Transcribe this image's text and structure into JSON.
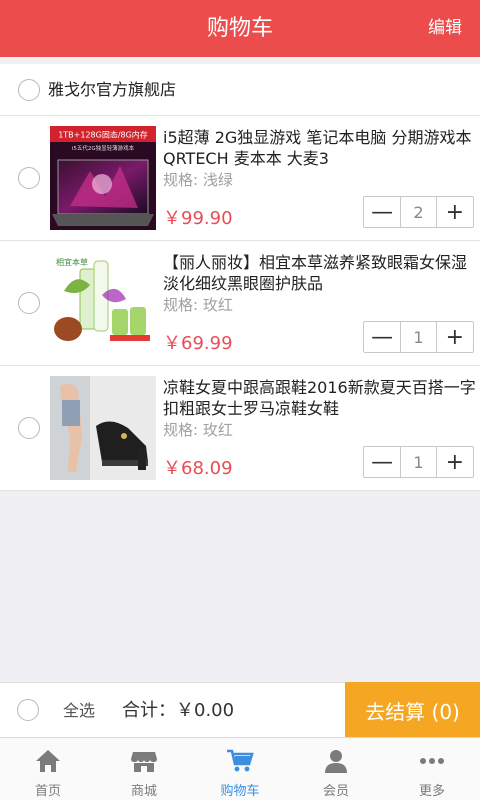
{
  "header": {
    "title": "购物车",
    "edit_label": "编辑"
  },
  "store": {
    "name": "雅戈尔官方旗舰店"
  },
  "items": [
    {
      "name": "i5超薄 2G独显游戏 笔记本电脑 分期游戏本 QRTECH 麦本本 大麦3",
      "spec": "规格: 浅绿",
      "price": "￥99.90",
      "qty": "2",
      "thumb_text_1": "1TB+128G固态/8G内存",
      "thumb_text_2": "i5五代2G独显轻薄游戏本"
    },
    {
      "name": "【丽人丽妆】相宜本草滋养紧致眼霜女保湿淡化细纹黑眼圈护肤品",
      "spec": "规格: 玫红",
      "price": "￥69.99",
      "qty": "1",
      "thumb_text_1": "相宜本草"
    },
    {
      "name": "凉鞋女夏中跟高跟鞋2016新款夏天百搭一字扣粗跟女士罗马凉鞋女鞋",
      "spec": "规格: 玫红",
      "price": "￥68.09",
      "qty": "1"
    }
  ],
  "stepper": {
    "minus": "—",
    "plus": "+"
  },
  "footer": {
    "select_all": "全选",
    "total": "合计：￥0.00",
    "checkout": "去结算 (0)"
  },
  "tabs": [
    {
      "label": "首页",
      "icon": "home-icon"
    },
    {
      "label": "商城",
      "icon": "store-icon"
    },
    {
      "label": "购物车",
      "icon": "cart-icon",
      "active": true
    },
    {
      "label": "会员",
      "icon": "member-icon"
    },
    {
      "label": "更多",
      "icon": "more-icon"
    }
  ],
  "colors": {
    "header": "#ec4c4c",
    "price": "#e84e56",
    "checkout": "#f5a623",
    "tab_active": "#3d8de0"
  }
}
